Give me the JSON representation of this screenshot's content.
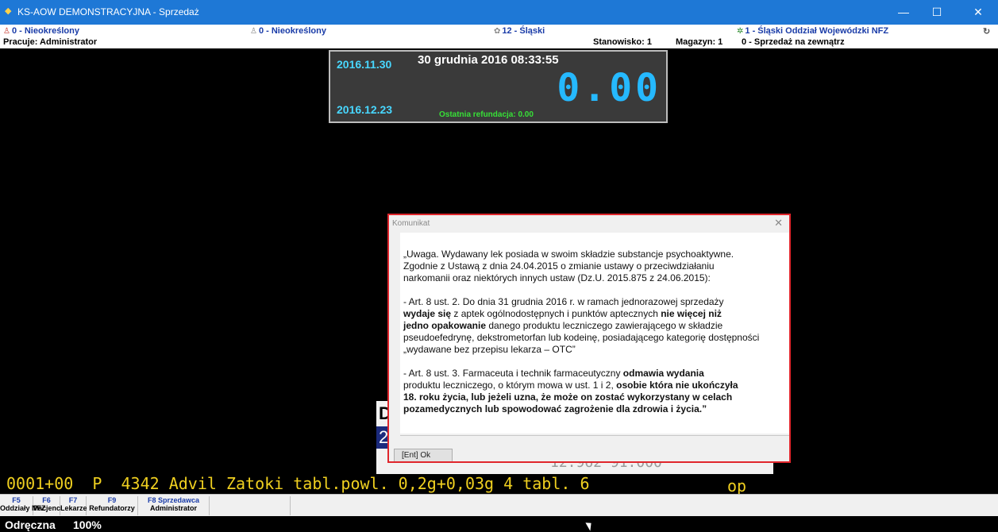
{
  "window": {
    "title": "KS-AOW DEMONSTRACYJNA - Sprzedaż",
    "app_icon": "app-diamond-icon",
    "min_glyph": "—",
    "max_glyph": "☐",
    "close_glyph": "✕"
  },
  "infobar": {
    "oddzial": "0 - Nieokreślony",
    "oddzial2": "0 - Nieokreślony",
    "region": "12 - Śląski",
    "nfz": "1 - Śląski Oddział Wojewódzki NFZ",
    "user": "Pracuje: Administrator",
    "stanowisko": "Stanowisko: 1",
    "magazyn": "Magazyn: 1",
    "tryb": "0 - Sprzedaż na zewnątrz"
  },
  "panel": {
    "date_top": "2016.11.30",
    "date_bottom": "2016.12.23",
    "datetime": "30 grudnia 2016  08:33:55",
    "amount": "0.00",
    "refund": "Ostatnia refundacja: 0.00"
  },
  "background": {
    "letter": "D",
    "digit": "2",
    "numbers": "12.962   91.000"
  },
  "dialog": {
    "title": "Komunikat",
    "close_glyph": "✕",
    "lines": [
      "„Uwaga. Wydawany lek posiada w swoim składzie substancje psychoaktywne.",
      "   Zgodnie z Ustawą z dnia 24.04.2015 o zmianie ustawy o przeciwdziałaniu",
      "   narkomanii oraz niektórych innych ustaw (Dz.U. 2015.875 z 24.06.2015):"
    ],
    "p2_a": "- Art. 8 ust. 2. Do dnia 31 grudnia 2016 r. w ramach jednorazowej sprzedaży",
    "p2_b_bold": " wydaje się",
    "p2_b": " z aptek ogólnodostępnych i punktów aptecznych ",
    "p2_b_bold2": "nie więcej niż",
    "p2_c_bold": " jedno opakowanie",
    "p2_c": " danego produktu leczniczego zawierającego w składzie",
    "p2_d": "pseudoefedrynę, dekstrometorfan lub kodeinę, posiadającego kategorię dostępności",
    "p2_e": "„wydawane bez przepisu lekarza – OTC”",
    "p3_a": "- Art. 8 ust. 3. Farmaceuta i technik farmaceutyczny ",
    "p3_a_bold": "odmawia wydania",
    "p3_b": "produktu leczniczego, o którym mowa w ust. 1 i 2, ",
    "p3_b_bold": "osobie która nie ukończyła",
    "p3_c_bold": "18. roku życia, lub jeżeli uzna, że może on zostać wykorzystany w celach",
    "p3_d_bold": "pozamedycznych lub spowodować zagrożenie dla zdrowia i życia.”",
    "ok_label": "[Ent] Ok"
  },
  "receipt": {
    "line": "0001+00  P  4342 Advil Zatoki tabl.powl. 0,2g+0,03g 4 tabl. 6",
    "unit": "op"
  },
  "fkeys": [
    {
      "key": "F5",
      "label": "Oddziały NFZ"
    },
    {
      "key": "F6",
      "label": "Pacjenci"
    },
    {
      "key": "F7",
      "label": "Lekarze"
    },
    {
      "key": "F9",
      "label": "Refundatorzy"
    },
    {
      "key": "F8 Sprzedawca",
      "label": "Administrator"
    }
  ],
  "status": {
    "mode": "Odręczna",
    "percent": "100%"
  }
}
